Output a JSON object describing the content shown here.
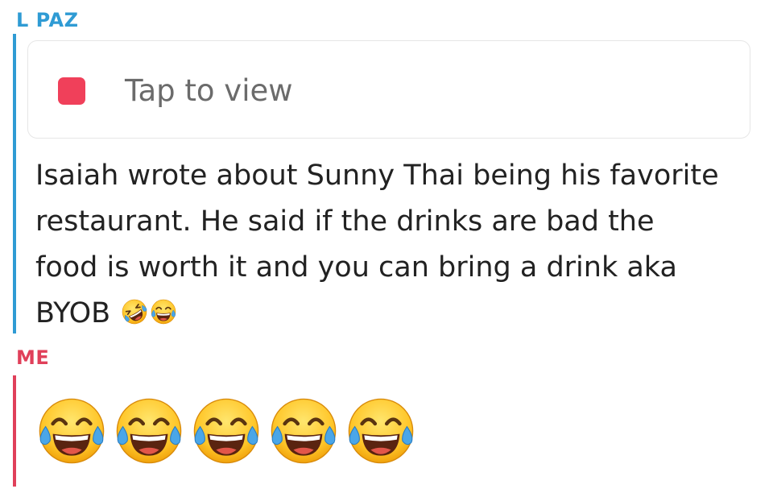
{
  "chat": {
    "messages": [
      {
        "sender": "L PAZ",
        "sender_color": "#2f9bd4",
        "snap": {
          "label": "Tap to view",
          "indicator_color": "#f0405a",
          "indicator_icon": "red-snap-square-icon"
        },
        "text": "Isaiah wrote about Sunny Thai being his favorite\nrestaurant. He said if the drinks are bad the\nfood is worth it and you can bring a drink aka\nBYOB ",
        "trailing_emojis": [
          "rolling-on-floor-laughing-emoji-icon",
          "tears-of-joy-emoji-icon"
        ]
      },
      {
        "sender": "ME",
        "sender_color": "#e0405a",
        "emojis": [
          "tears-of-joy-emoji-icon",
          "tears-of-joy-emoji-icon",
          "tears-of-joy-emoji-icon",
          "tears-of-joy-emoji-icon",
          "tears-of-joy-emoji-icon"
        ]
      }
    ]
  }
}
